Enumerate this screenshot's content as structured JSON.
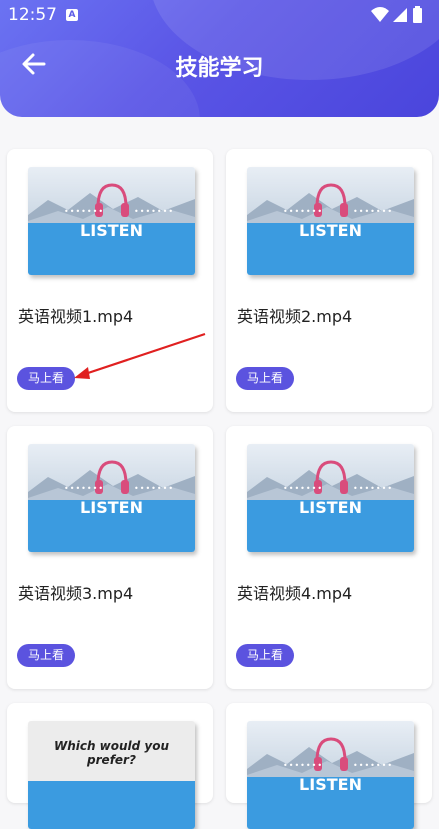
{
  "status_bar": {
    "time": "12:57",
    "a_badge": "A"
  },
  "header": {
    "title": "技能学习",
    "back_icon": "arrow-left-icon"
  },
  "colors": {
    "accent": "#5b53df",
    "header_start": "#6b73f2",
    "thumb_blue": "#3b9be0",
    "annotation_arrow": "#e02020"
  },
  "videos": [
    {
      "filename": "英语视频1.mp4",
      "button_label": "马上看",
      "thumb_text": "LISTEN"
    },
    {
      "filename": "英语视频2.mp4",
      "button_label": "马上看",
      "thumb_text": "LISTEN"
    },
    {
      "filename": "英语视频3.mp4",
      "button_label": "马上看",
      "thumb_text": "LISTEN"
    },
    {
      "filename": "英语视频4.mp4",
      "button_label": "马上看",
      "thumb_text": "LISTEN"
    },
    {
      "thumb_text": "Which would you prefer?"
    },
    {
      "thumb_text": "LISTEN"
    }
  ]
}
